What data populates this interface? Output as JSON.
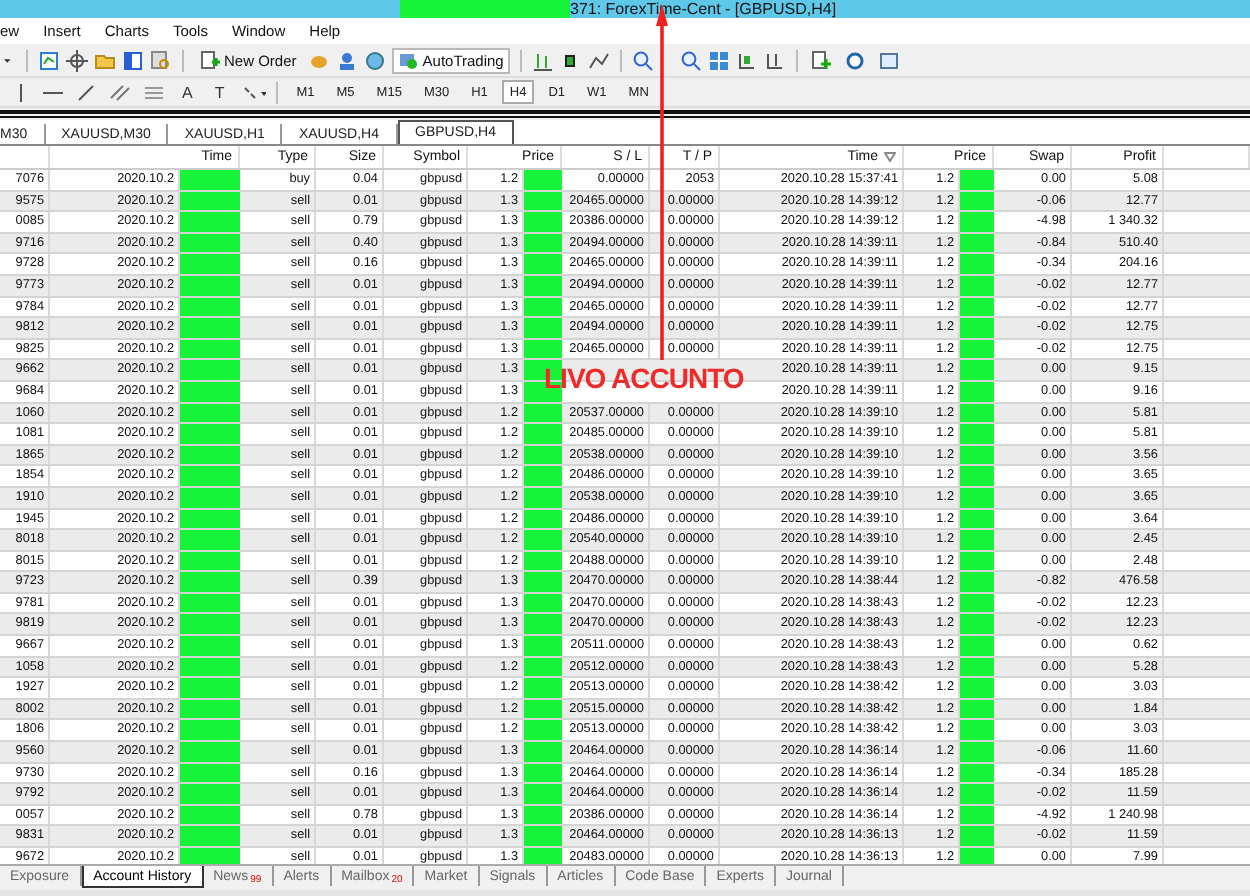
{
  "window": {
    "title": "371: ForexTime-Cent - [GBPUSD,H4]"
  },
  "menu": [
    "ew",
    "Insert",
    "Charts",
    "Tools",
    "Window",
    "Help"
  ],
  "toolbar": {
    "new_order": "New Order",
    "auto_trading": "AutoTrading"
  },
  "drawing_tools": [
    "A",
    "T"
  ],
  "timeframes": [
    {
      "label": "M1",
      "selected": false
    },
    {
      "label": "M5",
      "selected": false
    },
    {
      "label": "M15",
      "selected": false
    },
    {
      "label": "M30",
      "selected": false
    },
    {
      "label": "H1",
      "selected": false
    },
    {
      "label": "H4",
      "selected": true
    },
    {
      "label": "D1",
      "selected": false
    },
    {
      "label": "W1",
      "selected": false
    },
    {
      "label": "MN",
      "selected": false
    }
  ],
  "chart_tabs": [
    {
      "label": "M30",
      "selected": false
    },
    {
      "label": "XAUUSD,M30",
      "selected": false
    },
    {
      "label": "XAUUSD,H1",
      "selected": false
    },
    {
      "label": "XAUUSD,H4",
      "selected": false
    },
    {
      "label": "GBPUSD,H4",
      "selected": true
    }
  ],
  "table": {
    "columns": [
      "Time",
      "Type",
      "Size",
      "Symbol",
      "Price",
      "S / L",
      "T / P",
      "Time",
      "Price",
      "Swap",
      "Profit"
    ],
    "rows": [
      {
        "ticket": "7076",
        "open_time": "2020.10.2",
        "type": "buy",
        "size": "0.04",
        "symbol": "gbpusd",
        "open_price": "1.2",
        "sl": "0.00000",
        "tp": "2053",
        "close_time": "2020.10.28 15:37:41",
        "close_price": "1.2",
        "swap": "0.00",
        "profit": "5.08"
      },
      {
        "ticket": "9575",
        "open_time": "2020.10.2",
        "type": "sell",
        "size": "0.01",
        "symbol": "gbpusd",
        "open_price": "1.3",
        "sl": "20465.00000",
        "tp": "0.00000",
        "close_time": "2020.10.28 14:39:12",
        "close_price": "1.2",
        "swap": "-0.06",
        "profit": "12.77"
      },
      {
        "ticket": "0085",
        "open_time": "2020.10.2",
        "type": "sell",
        "size": "0.79",
        "symbol": "gbpusd",
        "open_price": "1.3",
        "sl": "20386.00000",
        "tp": "0.00000",
        "close_time": "2020.10.28 14:39:12",
        "close_price": "1.2",
        "swap": "-4.98",
        "profit": "1 340.32"
      },
      {
        "ticket": "9716",
        "open_time": "2020.10.2",
        "type": "sell",
        "size": "0.40",
        "symbol": "gbpusd",
        "open_price": "1.3",
        "sl": "20494.00000",
        "tp": "0.00000",
        "close_time": "2020.10.28 14:39:11",
        "close_price": "1.2",
        "swap": "-0.84",
        "profit": "510.40"
      },
      {
        "ticket": "9728",
        "open_time": "2020.10.2",
        "type": "sell",
        "size": "0.16",
        "symbol": "gbpusd",
        "open_price": "1.3",
        "sl": "20465.00000",
        "tp": "0.00000",
        "close_time": "2020.10.28 14:39:11",
        "close_price": "1.2",
        "swap": "-0.34",
        "profit": "204.16"
      },
      {
        "ticket": "9773",
        "open_time": "2020.10.2",
        "type": "sell",
        "size": "0.01",
        "symbol": "gbpusd",
        "open_price": "1.3",
        "sl": "20494.00000",
        "tp": "0.00000",
        "close_time": "2020.10.28 14:39:11",
        "close_price": "1.2",
        "swap": "-0.02",
        "profit": "12.77"
      },
      {
        "ticket": "9784",
        "open_time": "2020.10.2",
        "type": "sell",
        "size": "0.01",
        "symbol": "gbpusd",
        "open_price": "1.3",
        "sl": "20465.00000",
        "tp": "0.00000",
        "close_time": "2020.10.28 14:39:11",
        "close_price": "1.2",
        "swap": "-0.02",
        "profit": "12.77"
      },
      {
        "ticket": "9812",
        "open_time": "2020.10.2",
        "type": "sell",
        "size": "0.01",
        "symbol": "gbpusd",
        "open_price": "1.3",
        "sl": "20494.00000",
        "tp": "0.00000",
        "close_time": "2020.10.28 14:39:11",
        "close_price": "1.2",
        "swap": "-0.02",
        "profit": "12.75"
      },
      {
        "ticket": "9825",
        "open_time": "2020.10.2",
        "type": "sell",
        "size": "0.01",
        "symbol": "gbpusd",
        "open_price": "1.3",
        "sl": "20465.00000",
        "tp": "0.00000",
        "close_time": "2020.10.28 14:39:11",
        "close_price": "1.2",
        "swap": "-0.02",
        "profit": "12.75"
      },
      {
        "ticket": "9662",
        "open_time": "2020.10.2",
        "type": "sell",
        "size": "0.01",
        "symbol": "gbpusd",
        "open_price": "1.3",
        "close_time": "2020.10.28 14:39:11",
        "close_price": "1.2",
        "swap": "0.00",
        "profit": "9.15"
      },
      {
        "ticket": "9684",
        "open_time": "2020.10.2",
        "type": "sell",
        "size": "0.01",
        "symbol": "gbpusd",
        "open_price": "1.3",
        "close_time": "2020.10.28 14:39:11",
        "close_price": "1.2",
        "swap": "0.00",
        "profit": "9.16"
      },
      {
        "ticket": "1060",
        "open_time": "2020.10.2",
        "type": "sell",
        "size": "0.01",
        "symbol": "gbpusd",
        "open_price": "1.2",
        "sl": "20537.00000",
        "tp": "0.00000",
        "close_time": "2020.10.28 14:39:10",
        "close_price": "1.2",
        "swap": "0.00",
        "profit": "5.81"
      },
      {
        "ticket": "1081",
        "open_time": "2020.10.2",
        "type": "sell",
        "size": "0.01",
        "symbol": "gbpusd",
        "open_price": "1.2",
        "sl": "20485.00000",
        "tp": "0.00000",
        "close_time": "2020.10.28 14:39:10",
        "close_price": "1.2",
        "swap": "0.00",
        "profit": "5.81"
      },
      {
        "ticket": "1865",
        "open_time": "2020.10.2",
        "type": "sell",
        "size": "0.01",
        "symbol": "gbpusd",
        "open_price": "1.2",
        "sl": "20538.00000",
        "tp": "0.00000",
        "close_time": "2020.10.28 14:39:10",
        "close_price": "1.2",
        "swap": "0.00",
        "profit": "3.56"
      },
      {
        "ticket": "1854",
        "open_time": "2020.10.2",
        "type": "sell",
        "size": "0.01",
        "symbol": "gbpusd",
        "open_price": "1.2",
        "sl": "20486.00000",
        "tp": "0.00000",
        "close_time": "2020.10.28 14:39:10",
        "close_price": "1.2",
        "swap": "0.00",
        "profit": "3.65"
      },
      {
        "ticket": "1910",
        "open_time": "2020.10.2",
        "type": "sell",
        "size": "0.01",
        "symbol": "gbpusd",
        "open_price": "1.2",
        "sl": "20538.00000",
        "tp": "0.00000",
        "close_time": "2020.10.28 14:39:10",
        "close_price": "1.2",
        "swap": "0.00",
        "profit": "3.65"
      },
      {
        "ticket": "1945",
        "open_time": "2020.10.2",
        "type": "sell",
        "size": "0.01",
        "symbol": "gbpusd",
        "open_price": "1.2",
        "sl": "20486.00000",
        "tp": "0.00000",
        "close_time": "2020.10.28 14:39:10",
        "close_price": "1.2",
        "swap": "0.00",
        "profit": "3.64"
      },
      {
        "ticket": "8018",
        "open_time": "2020.10.2",
        "type": "sell",
        "size": "0.01",
        "symbol": "gbpusd",
        "open_price": "1.2",
        "sl": "20540.00000",
        "tp": "0.00000",
        "close_time": "2020.10.28 14:39:10",
        "close_price": "1.2",
        "swap": "0.00",
        "profit": "2.45"
      },
      {
        "ticket": "8015",
        "open_time": "2020.10.2",
        "type": "sell",
        "size": "0.01",
        "symbol": "gbpusd",
        "open_price": "1.2",
        "sl": "20488.00000",
        "tp": "0.00000",
        "close_time": "2020.10.28 14:39:10",
        "close_price": "1.2",
        "swap": "0.00",
        "profit": "2.48"
      },
      {
        "ticket": "9723",
        "open_time": "2020.10.2",
        "type": "sell",
        "size": "0.39",
        "symbol": "gbpusd",
        "open_price": "1.3",
        "sl": "20470.00000",
        "tp": "0.00000",
        "close_time": "2020.10.28 14:38:44",
        "close_price": "1.2",
        "swap": "-0.82",
        "profit": "476.58"
      },
      {
        "ticket": "9781",
        "open_time": "2020.10.2",
        "type": "sell",
        "size": "0.01",
        "symbol": "gbpusd",
        "open_price": "1.3",
        "sl": "20470.00000",
        "tp": "0.00000",
        "close_time": "2020.10.28 14:38:43",
        "close_price": "1.2",
        "swap": "-0.02",
        "profit": "12.23"
      },
      {
        "ticket": "9819",
        "open_time": "2020.10.2",
        "type": "sell",
        "size": "0.01",
        "symbol": "gbpusd",
        "open_price": "1.3",
        "sl": "20470.00000",
        "tp": "0.00000",
        "close_time": "2020.10.28 14:38:43",
        "close_price": "1.2",
        "swap": "-0.02",
        "profit": "12.23"
      },
      {
        "ticket": "9667",
        "open_time": "2020.10.2",
        "type": "sell",
        "size": "0.01",
        "symbol": "gbpusd",
        "open_price": "1.3",
        "sl": "20511.00000",
        "tp": "0.00000",
        "close_time": "2020.10.28 14:38:43",
        "close_price": "1.2",
        "swap": "0.00",
        "profit": "0.62"
      },
      {
        "ticket": "1058",
        "open_time": "2020.10.2",
        "type": "sell",
        "size": "0.01",
        "symbol": "gbpusd",
        "open_price": "1.2",
        "sl": "20512.00000",
        "tp": "0.00000",
        "close_time": "2020.10.28 14:38:43",
        "close_price": "1.2",
        "swap": "0.00",
        "profit": "5.28"
      },
      {
        "ticket": "1927",
        "open_time": "2020.10.2",
        "type": "sell",
        "size": "0.01",
        "symbol": "gbpusd",
        "open_price": "1.2",
        "sl": "20513.00000",
        "tp": "0.00000",
        "close_time": "2020.10.28 14:38:42",
        "close_price": "1.2",
        "swap": "0.00",
        "profit": "3.03"
      },
      {
        "ticket": "8002",
        "open_time": "2020.10.2",
        "type": "sell",
        "size": "0.01",
        "symbol": "gbpusd",
        "open_price": "1.2",
        "sl": "20515.00000",
        "tp": "0.00000",
        "close_time": "2020.10.28 14:38:42",
        "close_price": "1.2",
        "swap": "0.00",
        "profit": "1.84"
      },
      {
        "ticket": "1806",
        "open_time": "2020.10.2",
        "type": "sell",
        "size": "0.01",
        "symbol": "gbpusd",
        "open_price": "1.2",
        "sl": "20513.00000",
        "tp": "0.00000",
        "close_time": "2020.10.28 14:38:42",
        "close_price": "1.2",
        "swap": "0.00",
        "profit": "3.03"
      },
      {
        "ticket": "9560",
        "open_time": "2020.10.2",
        "type": "sell",
        "size": "0.01",
        "symbol": "gbpusd",
        "open_price": "1.3",
        "sl": "20464.00000",
        "tp": "0.00000",
        "close_time": "2020.10.28 14:36:14",
        "close_price": "1.2",
        "swap": "-0.06",
        "profit": "11.60"
      },
      {
        "ticket": "9730",
        "open_time": "2020.10.2",
        "type": "sell",
        "size": "0.16",
        "symbol": "gbpusd",
        "open_price": "1.3",
        "sl": "20464.00000",
        "tp": "0.00000",
        "close_time": "2020.10.28 14:36:14",
        "close_price": "1.2",
        "swap": "-0.34",
        "profit": "185.28"
      },
      {
        "ticket": "9792",
        "open_time": "2020.10.2",
        "type": "sell",
        "size": "0.01",
        "symbol": "gbpusd",
        "open_price": "1.3",
        "sl": "20464.00000",
        "tp": "0.00000",
        "close_time": "2020.10.28 14:36:14",
        "close_price": "1.2",
        "swap": "-0.02",
        "profit": "11.59"
      },
      {
        "ticket": "0057",
        "open_time": "2020.10.2",
        "type": "sell",
        "size": "0.78",
        "symbol": "gbpusd",
        "open_price": "1.3",
        "sl": "20386.00000",
        "tp": "0.00000",
        "close_time": "2020.10.28 14:36:14",
        "close_price": "1.2",
        "swap": "-4.92",
        "profit": "1 240.98"
      },
      {
        "ticket": "9831",
        "open_time": "2020.10.2",
        "type": "sell",
        "size": "0.01",
        "symbol": "gbpusd",
        "open_price": "1.3",
        "sl": "20464.00000",
        "tp": "0.00000",
        "close_time": "2020.10.28 14:36:13",
        "close_price": "1.2",
        "swap": "-0.02",
        "profit": "11.59"
      },
      {
        "ticket": "9672",
        "open_time": "2020.10.2",
        "type": "sell",
        "size": "0.01",
        "symbol": "gbpusd",
        "open_price": "1.3",
        "sl": "20483.00000",
        "tp": "0.00000",
        "close_time": "2020.10.28 14:36:13",
        "close_price": "1.2",
        "swap": "0.00",
        "profit": "7.99"
      }
    ]
  },
  "bottom_tabs": [
    {
      "label": "Exposure",
      "selected": false
    },
    {
      "label": "Account History",
      "selected": true
    },
    {
      "label": "News",
      "badge": "99",
      "selected": false
    },
    {
      "label": "Alerts",
      "selected": false
    },
    {
      "label": "Mailbox",
      "badge": "20",
      "selected": false
    },
    {
      "label": "Market",
      "selected": false
    },
    {
      "label": "Signals",
      "selected": false
    },
    {
      "label": "Articles",
      "selected": false
    },
    {
      "label": "Code Base",
      "selected": false
    },
    {
      "label": "Experts",
      "selected": false
    },
    {
      "label": "Journal",
      "selected": false
    }
  ],
  "annotation": {
    "text": "LIVO ACCUNTO"
  }
}
